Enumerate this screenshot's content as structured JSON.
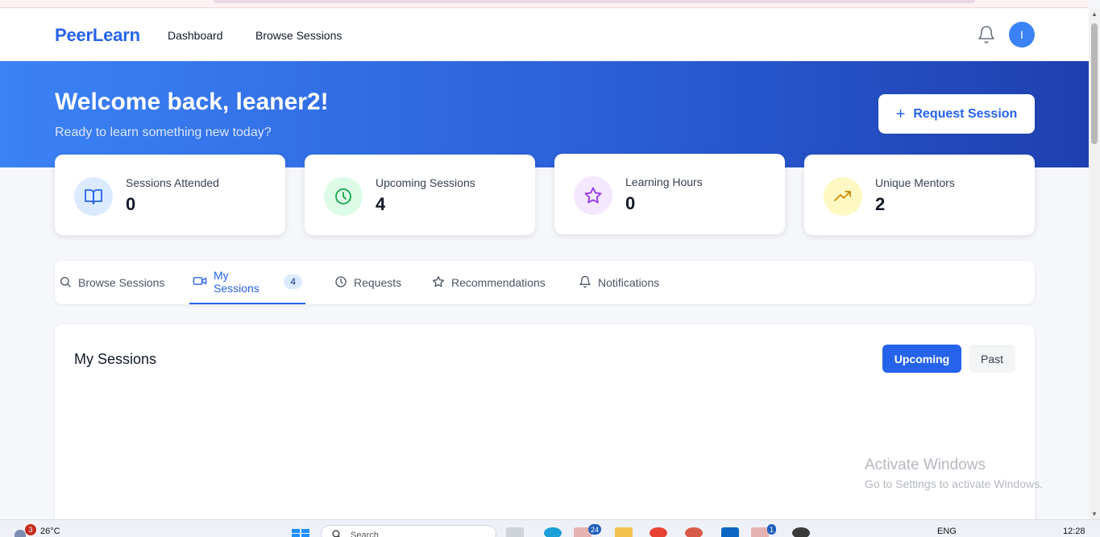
{
  "navbar": {
    "brand": "PeerLearn",
    "links": [
      "Dashboard",
      "Browse Sessions"
    ],
    "avatar_initial": "I"
  },
  "hero": {
    "title": "Welcome back, leaner2!",
    "subtitle": "Ready to learn something new today?",
    "request_button": "Request Session"
  },
  "stats": [
    {
      "label": "Sessions Attended",
      "value": "0",
      "icon": "book-open-icon",
      "icon_bg": "#dbeafe",
      "icon_color": "#2563eb"
    },
    {
      "label": "Upcoming Sessions",
      "value": "4",
      "icon": "clock-icon",
      "icon_bg": "#dcfce7",
      "icon_color": "#16a34a"
    },
    {
      "label": "Learning Hours",
      "value": "0",
      "icon": "star-icon",
      "icon_bg": "#f3e8ff",
      "icon_color": "#9333ea"
    },
    {
      "label": "Unique Mentors",
      "value": "2",
      "icon": "trending-up-icon",
      "icon_bg": "#fef9c3",
      "icon_color": "#ca8a04"
    }
  ],
  "tabs": [
    {
      "label": "Browse Sessions",
      "icon": "search-icon"
    },
    {
      "label": "My Sessions",
      "icon": "video-icon",
      "badge": "4",
      "active": true
    },
    {
      "label": "Requests",
      "icon": "clock-icon"
    },
    {
      "label": "Recommendations",
      "icon": "star-icon"
    },
    {
      "label": "Notifications",
      "icon": "bell-icon"
    }
  ],
  "panel": {
    "title": "My Sessions",
    "filters": [
      "Upcoming",
      "Past"
    ],
    "active_filter": "Upcoming"
  },
  "watermark": {
    "line1": "Activate Windows",
    "line2": "Go to Settings to activate Windows."
  },
  "taskbar": {
    "weather": "26°C",
    "weather_badge": "3",
    "search_placeholder": "Search",
    "app_badges": [
      "24",
      "1"
    ],
    "language": "ENG",
    "time": "12:28"
  },
  "colors": {
    "brand": "#2563eb",
    "hero_gradient_start": "#3b82f6",
    "hero_gradient_end": "#1e40af"
  }
}
